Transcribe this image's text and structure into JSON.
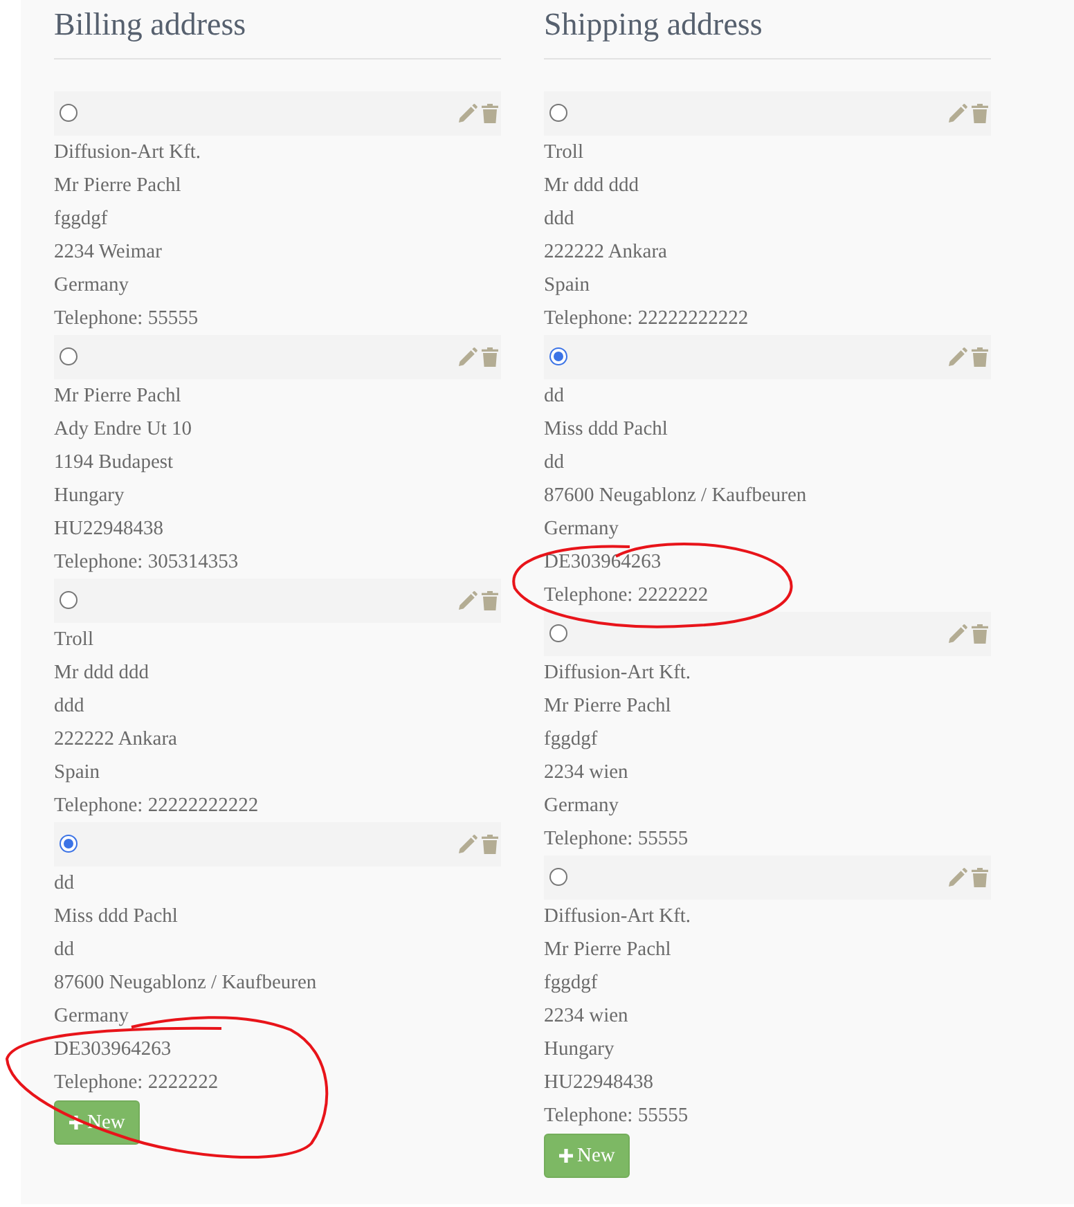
{
  "sections": [
    {
      "title": "Billing address",
      "addresses": [
        {
          "selected": false,
          "lines": [
            "Diffusion-Art Kft.",
            "Mr Pierre Pachl",
            "fggdgf",
            "2234 Weimar",
            "Germany",
            "Telephone: 55555"
          ]
        },
        {
          "selected": false,
          "lines": [
            "Mr Pierre Pachl",
            "Ady Endre Ut 10",
            "1194 Budapest",
            "Hungary",
            "HU22948438",
            "Telephone: 305314353"
          ]
        },
        {
          "selected": false,
          "lines": [
            "Troll",
            "Mr ddd ddd",
            "ddd",
            "222222 Ankara",
            "Spain",
            "Telephone: 22222222222"
          ]
        },
        {
          "selected": true,
          "lines": [
            "dd",
            "Miss ddd Pachl",
            "dd",
            "87600 Neugablonz / Kaufbeuren",
            "Germany",
            "DE303964263",
            "Telephone: 2222222"
          ]
        }
      ],
      "new_button": {
        "label": "New"
      }
    },
    {
      "title": "Shipping address",
      "addresses": [
        {
          "selected": false,
          "lines": [
            "Troll",
            "Mr ddd ddd",
            "ddd",
            "222222 Ankara",
            "Spain",
            "Telephone: 22222222222"
          ]
        },
        {
          "selected": true,
          "lines": [
            "dd",
            "Miss ddd Pachl",
            "dd",
            "87600 Neugablonz / Kaufbeuren",
            "Germany",
            "DE303964263",
            "Telephone: 2222222"
          ]
        },
        {
          "selected": false,
          "lines": [
            "Diffusion-Art Kft.",
            "Mr Pierre Pachl",
            "fggdgf",
            "2234 wien",
            "Germany",
            "Telephone: 55555"
          ]
        },
        {
          "selected": false,
          "lines": [
            "Diffusion-Art Kft.",
            "Mr Pierre Pachl",
            "fggdgf",
            "2234 wien",
            "Hungary",
            "HU22948438",
            "Telephone: 55555"
          ]
        }
      ],
      "new_button": {
        "label": "New"
      }
    }
  ]
}
